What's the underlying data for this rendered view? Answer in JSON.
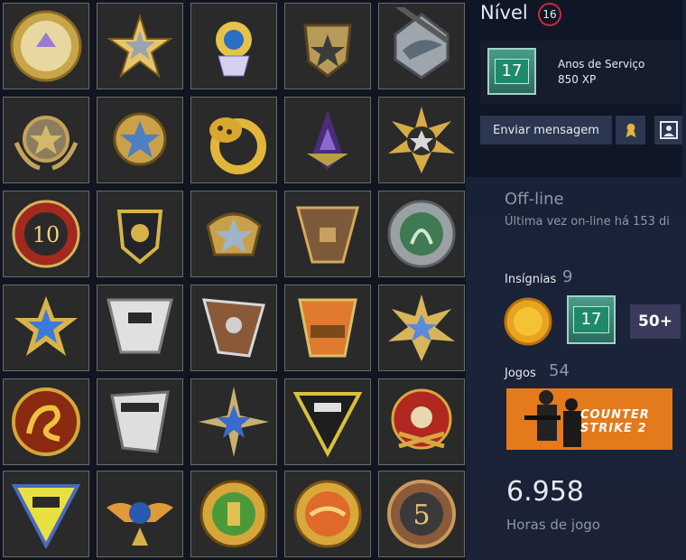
{
  "profile": {
    "level_label": "Nível",
    "level_value": "16",
    "xp_badge_number": "17",
    "xp_title": "Anos de Serviço",
    "xp_value": "850 XP",
    "send_message_label": "Enviar mensagem",
    "status": "Off-line",
    "last_online": "Última vez on-line há 153 di",
    "badges_label": "Insígnias",
    "badges_count": "9",
    "badge_years_number": "17",
    "badge_fifty_label": "50+",
    "games_label": "Jogos",
    "games_count": "54",
    "game_title_line1": "COUNTER",
    "game_title_line2": "STRIKE 2",
    "hours_value": "6.958",
    "hours_label": "Horas de jogo"
  },
  "colors": {
    "level_ring": "#c8283e",
    "xp_green": "#1e8a6a",
    "cs2_orange": "#e37a1c",
    "button": "#2b3650"
  },
  "medals": [
    "counter-strike-coin-icon",
    "star-medal-icon",
    "cupcake-pin-icon",
    "star-shield-medal-icon",
    "shark-emblem-icon",
    "wreath-star-medal-icon",
    "gold-star-medal-icon",
    "leopard-coin-icon",
    "purple-mantis-icon",
    "sunburst-star-medal-icon",
    "ten-year-coin-icon",
    "dark-shield-medal-icon",
    "gold-star-shield-icon",
    "krakow-2017-trophy-icon",
    "operation-hydra-coin-icon",
    "blue-star-medal-icon",
    "atlanta-pickem-trophy-icon",
    "cologne-pickem-trophy-icon",
    "columbus-pickem-trophy-icon",
    "blue-star-sunburst-icon",
    "dragon-coin-icon",
    "open-pickem-trophy-icon",
    "blue-compass-star-icon",
    "esl-one-pickem-trophy-icon",
    "skull-medal-icon",
    "esl-pickem-yellow-icon",
    "winged-medal-icon",
    "fist-coin-icon",
    "orange-eagle-coin-icon",
    "five-year-veteran-coin-icon"
  ]
}
